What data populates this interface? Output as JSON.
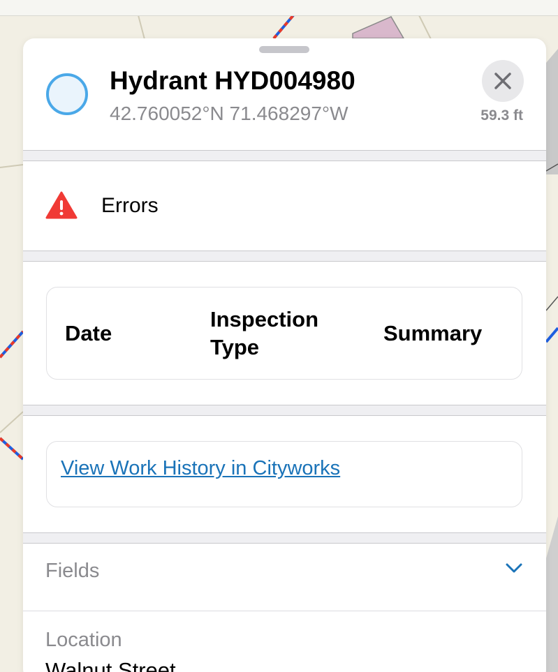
{
  "feature": {
    "title": "Hydrant HYD004980",
    "coordinates": "42.760052°N  71.468297°W",
    "distance": "59.3 ft",
    "symbol_color": "#4aa8e8"
  },
  "errors": {
    "label": "Errors",
    "icon": "warning-triangle-icon",
    "icon_color": "#f03a35"
  },
  "inspection_table": {
    "columns": [
      "Date",
      "Inspection\nType",
      "Summary"
    ]
  },
  "work_history": {
    "link_text": "View Work History in Cityworks",
    "link_color": "#1a73b8"
  },
  "fields": {
    "label": "Fields",
    "chevron_icon": "chevron-down-icon",
    "location_label": "Location",
    "location_value": "Walnut Street"
  },
  "icons": {
    "close": "close-icon"
  }
}
